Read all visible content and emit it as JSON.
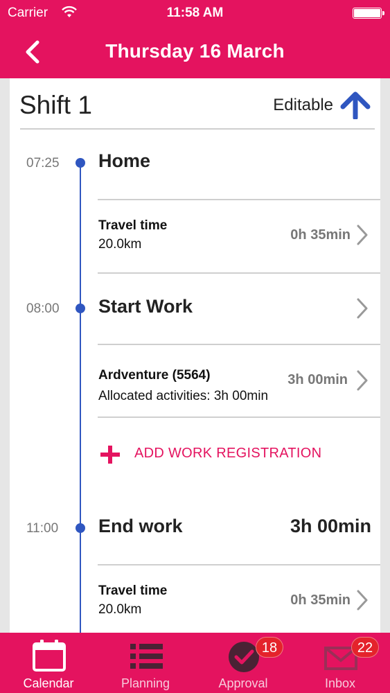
{
  "status_bar": {
    "carrier": "Carrier",
    "time": "11:58 AM"
  },
  "nav": {
    "title": "Thursday 16 March"
  },
  "shift": {
    "title": "Shift 1",
    "editable_label": "Editable"
  },
  "events": [
    {
      "time": "07:25",
      "title": "Home"
    },
    {
      "time": "08:00",
      "title": "Start Work"
    },
    {
      "time": "11:00",
      "title": "End work",
      "total": "3h 00min"
    }
  ],
  "rows": [
    {
      "title": "Travel time",
      "subtitle": "20.0km",
      "value": "0h 35min"
    },
    {
      "title": "Ardventure (5564)",
      "subtitle": "Allocated activities: 3h 00min",
      "value": "3h 00min"
    },
    {
      "title": "Travel time",
      "subtitle": "20.0km",
      "value": "0h 35min"
    }
  ],
  "add_work": {
    "label": "ADD WORK REGISTRATION"
  },
  "tabs": [
    {
      "label": "Calendar",
      "icon": "calendar-icon"
    },
    {
      "label": "Planning",
      "icon": "list-icon"
    },
    {
      "label": "Approval",
      "icon": "checkmark-icon",
      "badge": "18"
    },
    {
      "label": "Inbox",
      "icon": "envelope-icon",
      "badge": "22"
    }
  ],
  "colors": {
    "brand": "#e4135f",
    "timeline": "#2f56c0",
    "badge": "#e4232b"
  }
}
